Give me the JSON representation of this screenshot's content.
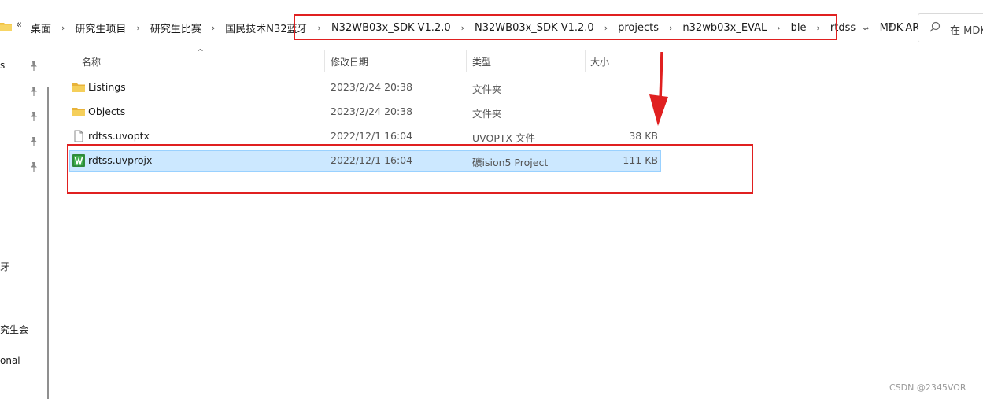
{
  "address": {
    "overflow_label": "«",
    "crumbs": [
      "桌面",
      "研究生项目",
      "研究生比赛",
      "国民技术N32蓝牙",
      "N32WB03x_SDK V1.2.0",
      "N32WB03x_SDK V1.2.0",
      "projects",
      "n32wb03x_EVAL",
      "ble",
      "rtdss",
      "MDK-ARM"
    ],
    "separator": "›",
    "dropdown_glyph": "⌄",
    "refresh_glyph": "↻"
  },
  "search": {
    "icon": "search-icon",
    "text": "在 MDK"
  },
  "nav": {
    "labels": [
      "s",
      "牙",
      "究生会",
      "onal"
    ],
    "pin_glyph": "📌"
  },
  "columns": {
    "name": "名称",
    "modified": "修改日期",
    "type": "类型",
    "size": "大小",
    "sort_glyph": "^"
  },
  "files": [
    {
      "name": "Listings",
      "modified": "2023/2/24 20:38",
      "type": "文件夹",
      "size": "",
      "icon": "folder-icon"
    },
    {
      "name": "Objects",
      "modified": "2023/2/24 20:38",
      "type": "文件夹",
      "size": "",
      "icon": "folder-icon"
    },
    {
      "name": "rdtss.uvoptx",
      "modified": "2022/12/1 16:04",
      "type": "UVOPTX 文件",
      "size": "38 KB",
      "icon": "file-icon"
    },
    {
      "name": "rdtss.uvprojx",
      "modified": "2022/12/1 16:04",
      "type": "礦ision5 Project",
      "size": "111 KB",
      "icon": "uvision-project-icon"
    }
  ],
  "watermark": "CSDN @2345VOR",
  "colors": {
    "highlight_red": "#e02020",
    "selection_bg": "#cce8ff",
    "folder_yellow": "#f0c040"
  }
}
